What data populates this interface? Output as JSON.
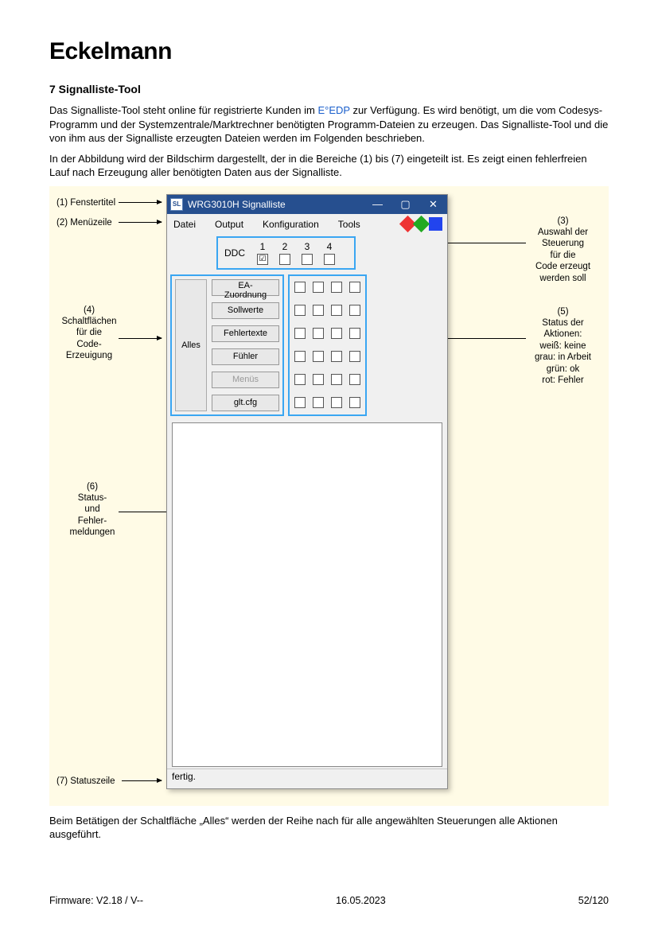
{
  "brand": "Eckelmann",
  "heading": "7 Signalliste-Tool",
  "para1_a": "Das Signalliste-Tool steht online für registrierte Kunden im ",
  "para1_link": "E°EDP",
  "para1_b": " zur Verfügung. Es wird benötigt, um die vom Codesys-Programm und der Systemzentrale/Marktrechner benötigten Programm-Dateien zu erzeugen. Das Signalliste-Tool und die von ihm aus der Signalliste erzeugten Dateien werden im Folgenden beschrieben.",
  "para2": "In der Abbildung wird der Bildschirm dargestellt, der in die Bereiche (1) bis (7) eingeteilt ist. Es zeigt einen fehlerfreien Lauf nach Erzeugung aller benötigten Daten aus der Signalliste.",
  "para3": "Beim Betätigen der Schaltfläche „Alles“ werden der Reihe nach für alle angewählten Steuerungen alle Aktionen ausgeführt.",
  "annotations": {
    "a1": "(1) Fenstertitel",
    "a2": "(2) Menüzeile",
    "a3": "(3)\nAuswahl der\nSteuerung\nfür die\nCode erzeugt\nwerden soll",
    "a4": "(4)\nSchaltflächen\nfür die\nCode-\nErzeuigung",
    "a5": "(5)\nStatus der\nAktionen:\nweiß: keine\ngrau: in Arbeit\ngrün: ok\nrot: Fehler",
    "a6": "(6)\nStatus-\nund\nFehler-\nmeldungen",
    "a7": "(7) Statuszeile"
  },
  "window": {
    "title": "WRG3010H Signalliste",
    "icon_text": "SL",
    "minimize": "—",
    "maximize": "▢",
    "close": "✕",
    "menu": {
      "m1": "Datei",
      "m2": "Output",
      "m3": "Konfiguration",
      "m4": "Tools"
    },
    "ddc_label": "DDC",
    "ddc_cols": {
      "c1": "1",
      "c2": "2",
      "c3": "3",
      "c4": "4"
    },
    "ddc_checked": "☑",
    "alles": "Alles",
    "buttons": {
      "b1": "EA-Zuordnung",
      "b2": "Sollwerte",
      "b3": "Fehlertexte",
      "b4": "Fühler",
      "b5": "Menüs",
      "b6": "glt.cfg"
    },
    "status": "fertig."
  },
  "footer": {
    "left": "Firmware: V2.18 / V--",
    "center": "16.05.2023",
    "right": "52/120"
  }
}
